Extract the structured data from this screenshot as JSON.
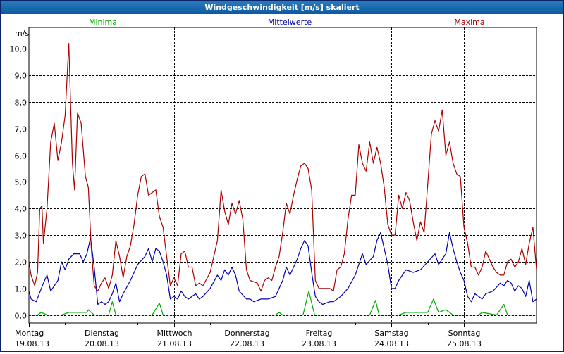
{
  "window": {
    "title": "Windgeschwindigkeit [m/s] skaliert"
  },
  "chart_data": {
    "type": "line",
    "title": "Windgeschwindigkeit [m/s] skaliert",
    "ylabel": "m/s",
    "ylim": [
      -0.3,
      10.8
    ],
    "xlim": [
      0,
      7
    ],
    "grid": true,
    "legend_position": "top",
    "y_ticks": [
      "0,0",
      "1,0",
      "2,0",
      "3,0",
      "4,0",
      "5,0",
      "6,0",
      "7,0",
      "8,0",
      "9,0",
      "10,0"
    ],
    "x_ticks": [
      {
        "day": "Montag",
        "date": "19.08.13"
      },
      {
        "day": "Dienstag",
        "date": "20.08.13"
      },
      {
        "day": "Mittwoch",
        "date": "21.08.13"
      },
      {
        "day": "Donnerstag",
        "date": "22.08.13"
      },
      {
        "day": "Freitag",
        "date": "23.08.13"
      },
      {
        "day": "Samstag",
        "date": "24.08.13"
      },
      {
        "day": "Sonntag",
        "date": "25.08.13"
      }
    ],
    "series": [
      {
        "name": "Minima",
        "color": "#00aa00",
        "points": [
          [
            0,
            0
          ],
          [
            0.12,
            0
          ],
          [
            0.17,
            0.1
          ],
          [
            0.25,
            0
          ],
          [
            0.45,
            0
          ],
          [
            0.55,
            0.1
          ],
          [
            0.8,
            0.1
          ],
          [
            0.82,
            0.2
          ],
          [
            0.9,
            0
          ],
          [
            1.1,
            0
          ],
          [
            1.15,
            0.5
          ],
          [
            1.2,
            0
          ],
          [
            1.7,
            0
          ],
          [
            1.8,
            0.45
          ],
          [
            1.85,
            0
          ],
          [
            3.4,
            0
          ],
          [
            3.45,
            0.1
          ],
          [
            3.5,
            0
          ],
          [
            3.78,
            0
          ],
          [
            3.86,
            0.9
          ],
          [
            3.94,
            0
          ],
          [
            4.7,
            0
          ],
          [
            4.78,
            0.55
          ],
          [
            4.83,
            0
          ],
          [
            5.1,
            0
          ],
          [
            5.2,
            0.1
          ],
          [
            5.5,
            0.1
          ],
          [
            5.58,
            0.6
          ],
          [
            5.65,
            0.1
          ],
          [
            5.75,
            0.2
          ],
          [
            5.85,
            0
          ],
          [
            6.2,
            0
          ],
          [
            6.25,
            0.1
          ],
          [
            6.45,
            0
          ],
          [
            6.55,
            0.4
          ],
          [
            6.6,
            0
          ],
          [
            7,
            0
          ]
        ]
      },
      {
        "name": "Mittelwerte",
        "color": "#0000aa",
        "points": [
          [
            0,
            0.9
          ],
          [
            0.03,
            0.6
          ],
          [
            0.1,
            0.5
          ],
          [
            0.2,
            1.2
          ],
          [
            0.25,
            1.5
          ],
          [
            0.3,
            0.9
          ],
          [
            0.4,
            1.3
          ],
          [
            0.45,
            2
          ],
          [
            0.5,
            1.7
          ],
          [
            0.55,
            2.1
          ],
          [
            0.62,
            2.3
          ],
          [
            0.7,
            2.3
          ],
          [
            0.75,
            2
          ],
          [
            0.8,
            2.3
          ],
          [
            0.85,
            2.9
          ],
          [
            0.9,
            1.8
          ],
          [
            0.95,
            0.4
          ],
          [
            1,
            0.5
          ],
          [
            1.05,
            0.4
          ],
          [
            1.1,
            0.5
          ],
          [
            1.15,
            0.8
          ],
          [
            1.2,
            1.2
          ],
          [
            1.25,
            0.5
          ],
          [
            1.3,
            0.8
          ],
          [
            1.4,
            1.3
          ],
          [
            1.5,
            1.9
          ],
          [
            1.6,
            2.2
          ],
          [
            1.65,
            2.5
          ],
          [
            1.7,
            2
          ],
          [
            1.75,
            2.5
          ],
          [
            1.8,
            2.4
          ],
          [
            1.85,
            2
          ],
          [
            1.9,
            1.5
          ],
          [
            1.95,
            0.6
          ],
          [
            2,
            0.7
          ],
          [
            2.05,
            0.6
          ],
          [
            2.1,
            0.9
          ],
          [
            2.15,
            0.7
          ],
          [
            2.2,
            0.6
          ],
          [
            2.3,
            0.8
          ],
          [
            2.35,
            0.6
          ],
          [
            2.4,
            0.7
          ],
          [
            2.5,
            1
          ],
          [
            2.6,
            1.5
          ],
          [
            2.65,
            1.3
          ],
          [
            2.7,
            1.7
          ],
          [
            2.75,
            1.5
          ],
          [
            2.8,
            1.8
          ],
          [
            2.85,
            1.5
          ],
          [
            2.9,
            0.9
          ],
          [
            3,
            0.6
          ],
          [
            3.05,
            0.6
          ],
          [
            3.1,
            0.5
          ],
          [
            3.2,
            0.6
          ],
          [
            3.3,
            0.6
          ],
          [
            3.4,
            0.7
          ],
          [
            3.5,
            1.3
          ],
          [
            3.55,
            1.8
          ],
          [
            3.6,
            1.5
          ],
          [
            3.7,
            2.1
          ],
          [
            3.75,
            2.5
          ],
          [
            3.8,
            2.8
          ],
          [
            3.85,
            2.6
          ],
          [
            3.9,
            1.6
          ],
          [
            3.95,
            0.7
          ],
          [
            4,
            0.5
          ],
          [
            4.05,
            0.4
          ],
          [
            4.15,
            0.5
          ],
          [
            4.2,
            0.5
          ],
          [
            4.3,
            0.7
          ],
          [
            4.4,
            1
          ],
          [
            4.5,
            1.5
          ],
          [
            4.6,
            2.3
          ],
          [
            4.65,
            1.9
          ],
          [
            4.75,
            2.2
          ],
          [
            4.8,
            2.8
          ],
          [
            4.85,
            3.1
          ],
          [
            4.9,
            2.5
          ],
          [
            4.95,
            1.9
          ],
          [
            5,
            1
          ],
          [
            5.05,
            1
          ],
          [
            5.1,
            1.3
          ],
          [
            5.2,
            1.7
          ],
          [
            5.3,
            1.6
          ],
          [
            5.4,
            1.7
          ],
          [
            5.5,
            2
          ],
          [
            5.6,
            2.3
          ],
          [
            5.65,
            1.9
          ],
          [
            5.7,
            2.1
          ],
          [
            5.75,
            2.3
          ],
          [
            5.8,
            3.1
          ],
          [
            5.85,
            2.5
          ],
          [
            5.9,
            2
          ],
          [
            5.95,
            1.6
          ],
          [
            6,
            1.3
          ],
          [
            6.05,
            0.7
          ],
          [
            6.1,
            0.5
          ],
          [
            6.15,
            0.8
          ],
          [
            6.25,
            0.6
          ],
          [
            6.3,
            0.8
          ],
          [
            6.4,
            0.9
          ],
          [
            6.5,
            1.2
          ],
          [
            6.55,
            1.1
          ],
          [
            6.6,
            1.3
          ],
          [
            6.65,
            1.2
          ],
          [
            6.7,
            0.9
          ],
          [
            6.75,
            1.1
          ],
          [
            6.8,
            1
          ],
          [
            6.85,
            0.7
          ],
          [
            6.9,
            1.3
          ],
          [
            6.95,
            0.5
          ],
          [
            7,
            0.6
          ]
        ]
      },
      {
        "name": "Maxima",
        "color": "#aa0000",
        "points": [
          [
            0,
            2
          ],
          [
            0.03,
            1.5
          ],
          [
            0.08,
            1.1
          ],
          [
            0.12,
            1.6
          ],
          [
            0.15,
            4
          ],
          [
            0.18,
            4.1
          ],
          [
            0.2,
            2.7
          ],
          [
            0.25,
            4
          ],
          [
            0.3,
            6.5
          ],
          [
            0.35,
            7.2
          ],
          [
            0.4,
            5.8
          ],
          [
            0.45,
            6.5
          ],
          [
            0.5,
            7.5
          ],
          [
            0.55,
            10.2
          ],
          [
            0.6,
            5.7
          ],
          [
            0.63,
            4.7
          ],
          [
            0.67,
            7.6
          ],
          [
            0.72,
            7.2
          ],
          [
            0.78,
            5.2
          ],
          [
            0.82,
            4.8
          ],
          [
            0.86,
            2.5
          ],
          [
            0.9,
            1.1
          ],
          [
            0.95,
            0.9
          ],
          [
            1,
            1.2
          ],
          [
            1.05,
            1.4
          ],
          [
            1.1,
            1
          ],
          [
            1.15,
            1.5
          ],
          [
            1.2,
            2.8
          ],
          [
            1.25,
            2.2
          ],
          [
            1.3,
            1.4
          ],
          [
            1.35,
            2.2
          ],
          [
            1.4,
            2.6
          ],
          [
            1.45,
            3.4
          ],
          [
            1.5,
            4.5
          ],
          [
            1.55,
            5.2
          ],
          [
            1.6,
            5.3
          ],
          [
            1.65,
            4.5
          ],
          [
            1.7,
            4.6
          ],
          [
            1.75,
            4.7
          ],
          [
            1.8,
            3.7
          ],
          [
            1.85,
            3.3
          ],
          [
            1.9,
            2.2
          ],
          [
            1.95,
            1.1
          ],
          [
            2,
            1.4
          ],
          [
            2.05,
            1.1
          ],
          [
            2.1,
            2.3
          ],
          [
            2.15,
            2.4
          ],
          [
            2.2,
            1.8
          ],
          [
            2.25,
            1.8
          ],
          [
            2.3,
            1.1
          ],
          [
            2.35,
            1.2
          ],
          [
            2.4,
            1.1
          ],
          [
            2.5,
            1.6
          ],
          [
            2.6,
            2.8
          ],
          [
            2.65,
            4.7
          ],
          [
            2.7,
            3.9
          ],
          [
            2.75,
            3.4
          ],
          [
            2.8,
            4.2
          ],
          [
            2.85,
            3.8
          ],
          [
            2.9,
            4.3
          ],
          [
            2.95,
            3.6
          ],
          [
            3,
            1.7
          ],
          [
            3.05,
            1.3
          ],
          [
            3.15,
            1.2
          ],
          [
            3.2,
            0.9
          ],
          [
            3.25,
            1.3
          ],
          [
            3.3,
            1.4
          ],
          [
            3.35,
            1.3
          ],
          [
            3.4,
            1.8
          ],
          [
            3.45,
            2.2
          ],
          [
            3.5,
            3.1
          ],
          [
            3.55,
            4.2
          ],
          [
            3.6,
            3.8
          ],
          [
            3.65,
            4.5
          ],
          [
            3.7,
            5.1
          ],
          [
            3.75,
            5.6
          ],
          [
            3.8,
            5.7
          ],
          [
            3.85,
            5.5
          ],
          [
            3.9,
            4.7
          ],
          [
            3.95,
            1.3
          ],
          [
            4,
            1
          ],
          [
            4.05,
            1
          ],
          [
            4.1,
            1
          ],
          [
            4.15,
            1
          ],
          [
            4.2,
            0.9
          ],
          [
            4.25,
            1.7
          ],
          [
            4.3,
            1.8
          ],
          [
            4.35,
            2.3
          ],
          [
            4.4,
            3.6
          ],
          [
            4.45,
            4.5
          ],
          [
            4.5,
            4.5
          ],
          [
            4.55,
            6.4
          ],
          [
            4.6,
            5.7
          ],
          [
            4.65,
            5.4
          ],
          [
            4.7,
            6.5
          ],
          [
            4.75,
            5.7
          ],
          [
            4.8,
            6.3
          ],
          [
            4.85,
            5.7
          ],
          [
            4.9,
            4.8
          ],
          [
            4.95,
            3.4
          ],
          [
            5,
            3
          ],
          [
            5.05,
            3
          ],
          [
            5.1,
            4.5
          ],
          [
            5.15,
            4
          ],
          [
            5.2,
            4.6
          ],
          [
            5.25,
            4.3
          ],
          [
            5.3,
            3.5
          ],
          [
            5.35,
            2.8
          ],
          [
            5.4,
            3.5
          ],
          [
            5.45,
            3.1
          ],
          [
            5.5,
            4.9
          ],
          [
            5.55,
            6.8
          ],
          [
            5.6,
            7.3
          ],
          [
            5.65,
            6.9
          ],
          [
            5.7,
            7.7
          ],
          [
            5.75,
            6
          ],
          [
            5.8,
            6.5
          ],
          [
            5.85,
            5.7
          ],
          [
            5.9,
            5.3
          ],
          [
            5.95,
            5.2
          ],
          [
            6,
            3.3
          ],
          [
            6.05,
            2.7
          ],
          [
            6.1,
            1.8
          ],
          [
            6.15,
            1.8
          ],
          [
            6.2,
            1.5
          ],
          [
            6.25,
            1.8
          ],
          [
            6.3,
            2.4
          ],
          [
            6.35,
            2.1
          ],
          [
            6.4,
            1.8
          ],
          [
            6.45,
            1.6
          ],
          [
            6.5,
            1.5
          ],
          [
            6.55,
            1.5
          ],
          [
            6.6,
            2
          ],
          [
            6.65,
            2.1
          ],
          [
            6.7,
            1.8
          ],
          [
            6.75,
            2
          ],
          [
            6.8,
            2.5
          ],
          [
            6.85,
            1.9
          ],
          [
            6.9,
            2.7
          ],
          [
            6.95,
            3.3
          ],
          [
            7,
            1.7
          ]
        ]
      }
    ]
  }
}
